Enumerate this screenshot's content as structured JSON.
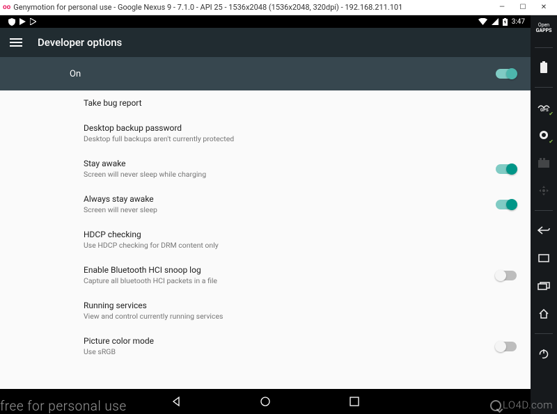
{
  "window": {
    "title": "Genymotion for personal use - Google Nexus 9 - 7.1.0 - API 25 - 1536x2048 (1536x2048, 320dpi) - 192.168.211.101",
    "logo": "oo",
    "minimize": "—",
    "maximize": "☐",
    "close": "✕"
  },
  "status": {
    "time": "3:47"
  },
  "toolbar": {
    "title": "Developer options"
  },
  "master": {
    "label": "On",
    "on": true
  },
  "settings": [
    {
      "title": "Take bug report",
      "sub": "",
      "switch": null
    },
    {
      "title": "Desktop backup password",
      "sub": "Desktop full backups aren't currently protected",
      "switch": null
    },
    {
      "title": "Stay awake",
      "sub": "Screen will never sleep while charging",
      "switch": true
    },
    {
      "title": "Always stay awake",
      "sub": "Screen will never sleep",
      "switch": true
    },
    {
      "title": "HDCP checking",
      "sub": "Use HDCP checking for DRM content only",
      "switch": null
    },
    {
      "title": "Enable Bluetooth HCI snoop log",
      "sub": "Capture all bluetooth HCI packets in a file",
      "switch": false
    },
    {
      "title": "Running services",
      "sub": "View and control currently running services",
      "switch": null
    },
    {
      "title": "Picture color mode",
      "sub": "Use sRGB",
      "switch": false
    }
  ],
  "geny_sidebar": {
    "opengapps": "Open GAPPS"
  },
  "watermark": {
    "left": "free for personal use",
    "right": "LO4D.com"
  }
}
